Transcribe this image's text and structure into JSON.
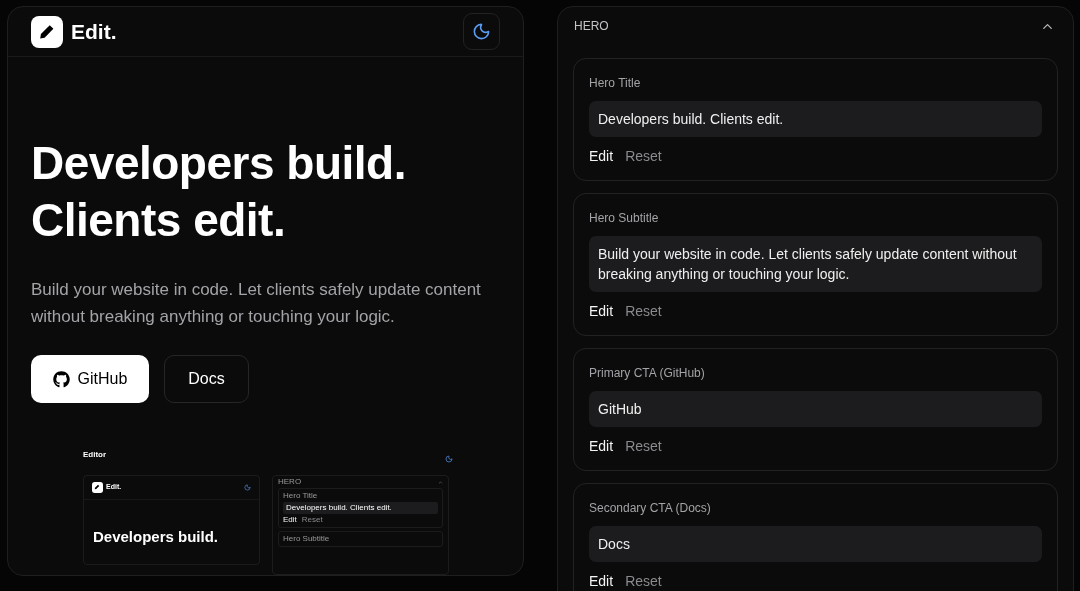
{
  "brand": {
    "name": "Edit."
  },
  "hero": {
    "title_lines": [
      "Developers build.",
      "Clients edit."
    ],
    "subtitle": "Build your website in code. Let clients safely update content without breaking anything or touching your logic.",
    "buttons": [
      {
        "label": "GitHub",
        "kind": "primary"
      },
      {
        "label": "Docs",
        "kind": "secondary"
      }
    ]
  },
  "preview": {
    "title": "Editor",
    "brand": "Edit.",
    "hero_title": "Developers build.",
    "section": "HERO",
    "fields": [
      {
        "label": "Hero Title",
        "value": "Developers build. Clients edit.",
        "actions": [
          {
            "label": "Edit",
            "kind": "primary"
          },
          {
            "label": "Reset",
            "kind": "secondary"
          }
        ]
      },
      {
        "label": "Hero Subtitle"
      }
    ]
  },
  "editor": {
    "section": "HERO",
    "expanded": true,
    "fields": [
      {
        "label": "Hero Title",
        "value": "Developers build. Clients edit.",
        "actions": [
          {
            "label": "Edit",
            "kind": "primary"
          },
          {
            "label": "Reset",
            "kind": "secondary"
          }
        ]
      },
      {
        "label": "Hero Subtitle",
        "value": "Build your website in code. Let clients safely update content without breaking anything or touching your logic.",
        "actions": [
          {
            "label": "Edit",
            "kind": "primary"
          },
          {
            "label": "Reset",
            "kind": "secondary"
          }
        ]
      },
      {
        "label": "Primary CTA (GitHub)",
        "value": "GitHub",
        "actions": [
          {
            "label": "Edit",
            "kind": "primary"
          },
          {
            "label": "Reset",
            "kind": "secondary"
          }
        ]
      },
      {
        "label": "Secondary CTA (Docs)",
        "value": "Docs",
        "actions": [
          {
            "label": "Edit",
            "kind": "primary"
          },
          {
            "label": "Reset",
            "kind": "secondary"
          }
        ]
      }
    ]
  }
}
